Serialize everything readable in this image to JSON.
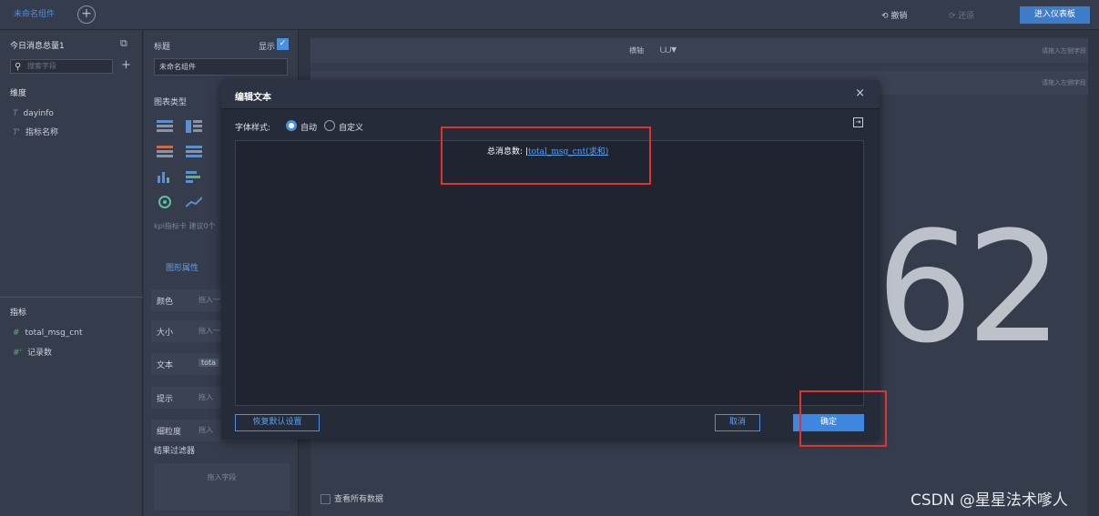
{
  "topbar": {
    "active_tab": "未命名组件",
    "add_tab": "+",
    "undo": "撤销",
    "redo": "还原",
    "enter_dashboard": "进入仪表板"
  },
  "left_panel": {
    "dataset_title": "今日消息总量1",
    "search_placeholder": "搜索字段",
    "dimension_title": "维度",
    "dimensions": [
      "dayinfo",
      "指标名称"
    ],
    "metric_title": "指标",
    "metrics": [
      "total_msg_cnt",
      "记录数"
    ]
  },
  "mid_panel": {
    "title_label": "标题",
    "show_label": "显示",
    "title_value": "未命名组件",
    "chart_type_label": "图表类型",
    "kpi_hint": "kpi指标卡 建议0个",
    "graph_props": "图形属性",
    "rows": [
      {
        "label": "颜色",
        "drop": "拖入一"
      },
      {
        "label": "大小",
        "drop": "拖入一"
      },
      {
        "label": "文本",
        "drop": "tota"
      },
      {
        "label": "提示",
        "drop": "拖入"
      },
      {
        "label": "细粒度",
        "drop": "拖入"
      }
    ],
    "filter_title": "结果过滤器",
    "filter_drop": "拖入字段"
  },
  "canvas": {
    "axis_label": "横轴",
    "axis_hint_1": "请拖入左侧字段",
    "axis_hint_2": "请拖入左侧字段",
    "big_number": "62",
    "view_all": "查看所有数据"
  },
  "dialog": {
    "title": "编辑文本",
    "close": "×",
    "font_style_label": "字体样式:",
    "radio_auto": "自动",
    "radio_custom": "自定义",
    "editor_prefix": "总消息数: ",
    "editor_token": "total_msg_cnt(求和)",
    "reset_button": "恢复默认设置",
    "cancel_button": "取消",
    "ok_button": "确定"
  },
  "watermark": "CSDN @星星法术嗲人"
}
